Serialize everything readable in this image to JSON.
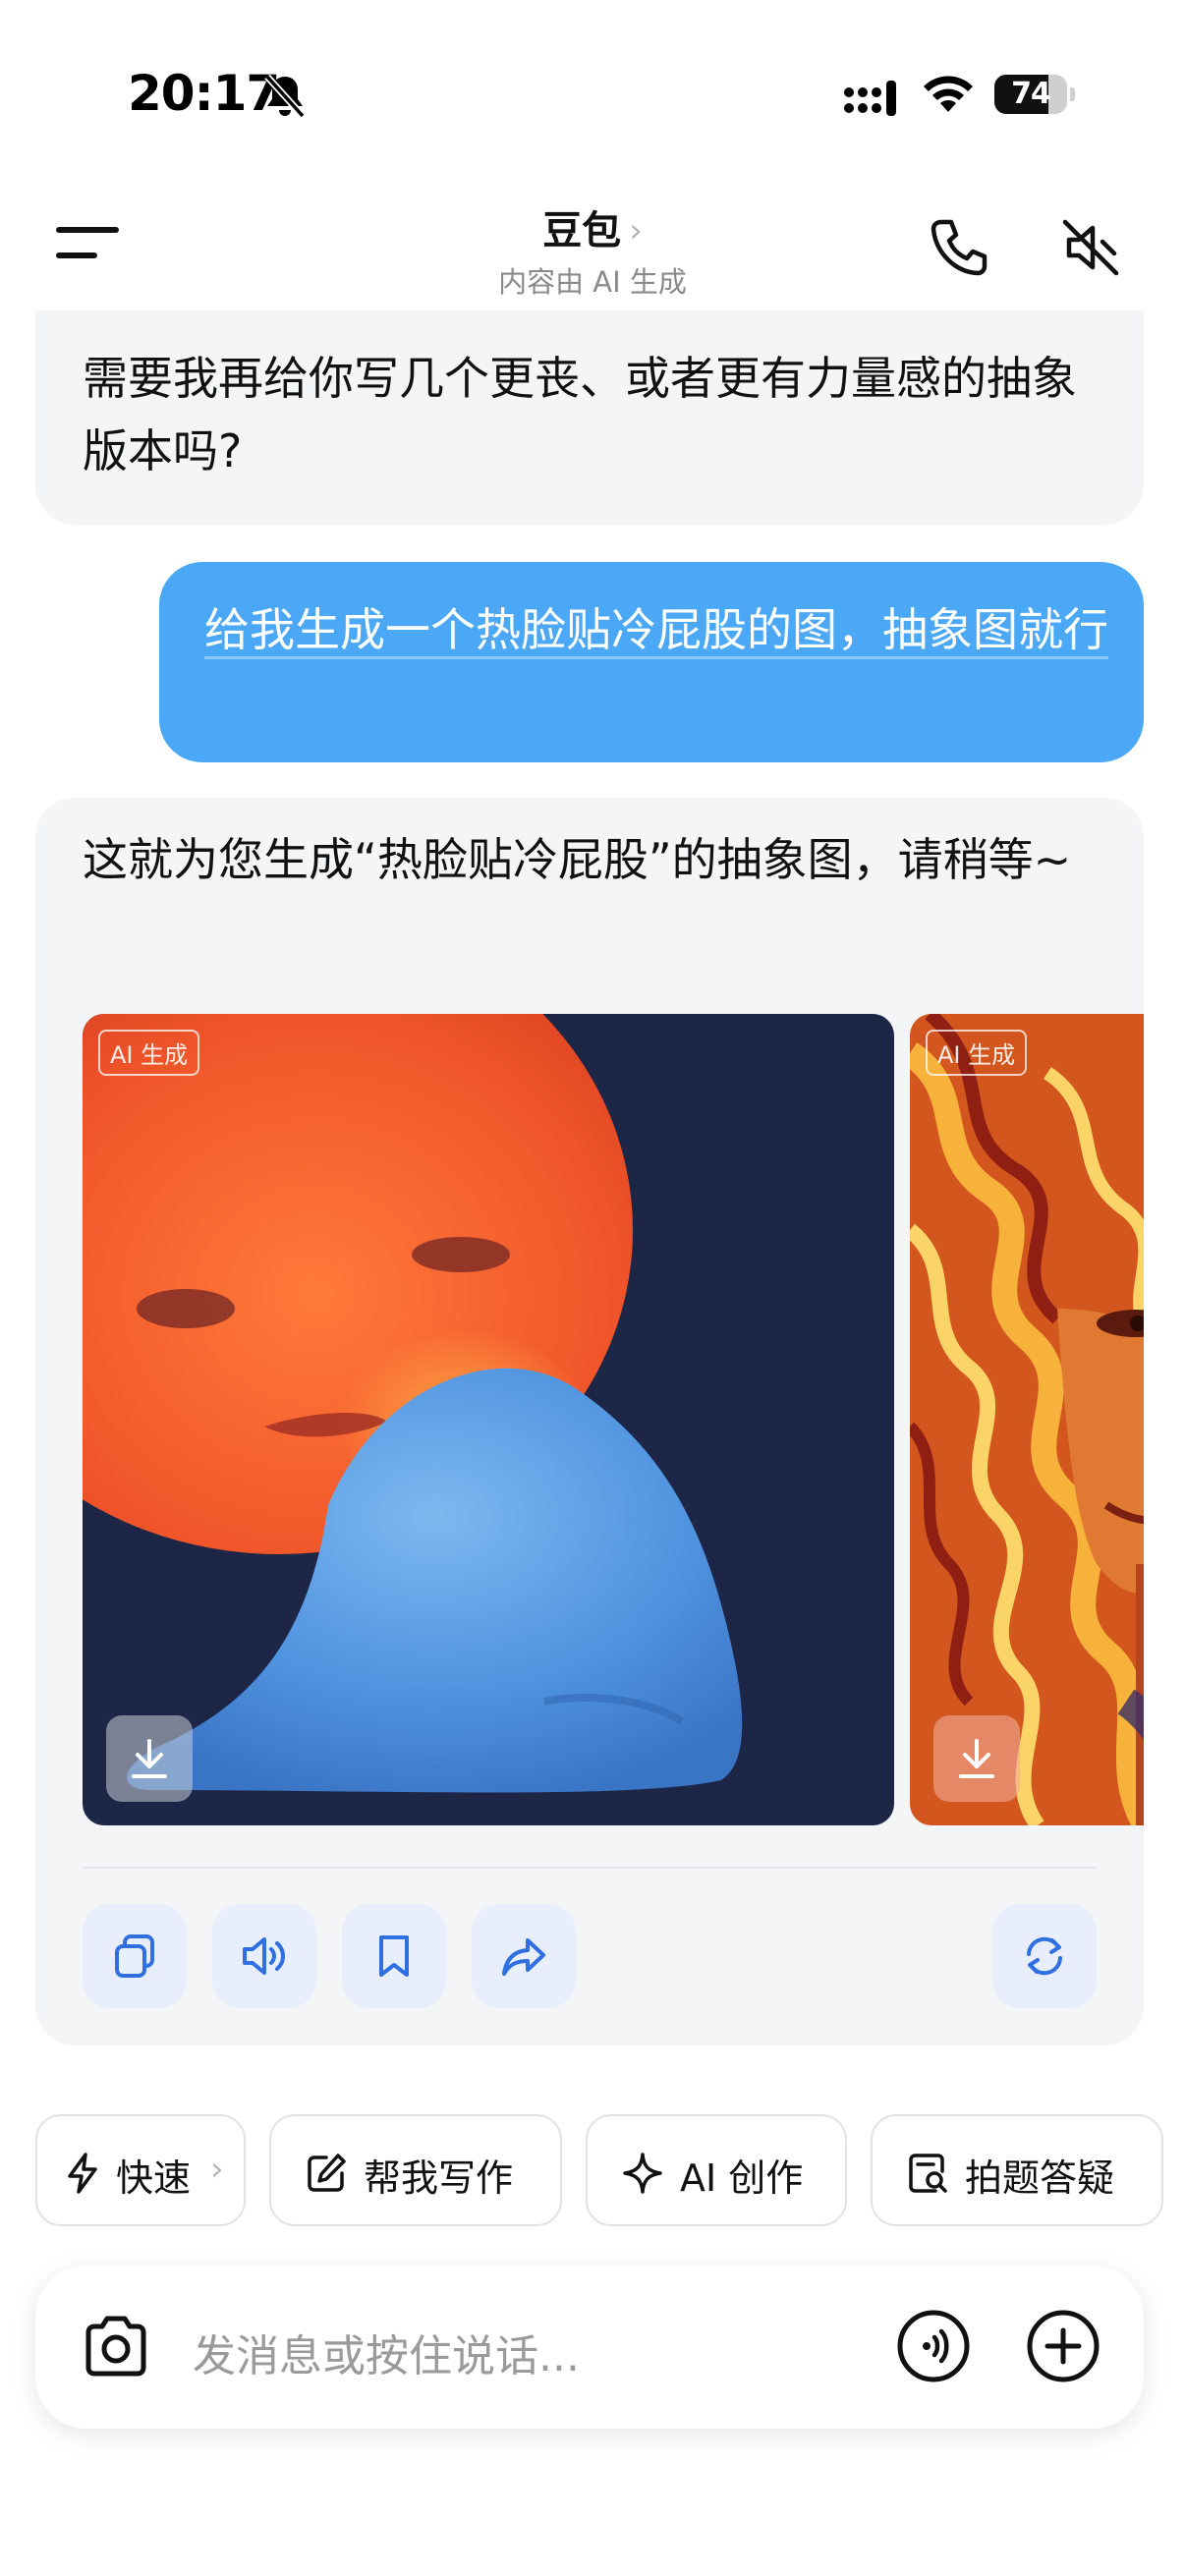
{
  "status_bar": {
    "time": "20:17",
    "battery_level": "74",
    "battery_fraction": 0.74,
    "icons": [
      "bell-slash-icon",
      "cellular-signal-icon",
      "wifi-icon",
      "battery-icon"
    ]
  },
  "header": {
    "title": "豆包",
    "title_chevron": "›",
    "subtitle": "内容由 AI 生成",
    "icons": [
      "menu-icon",
      "phone-icon",
      "speaker-mute-icon"
    ]
  },
  "messages": [
    {
      "role": "assistant",
      "text": "需要我再给你写几个更丧、或者更有力量感的抽象版本吗?"
    },
    {
      "role": "user",
      "text": "给我生成一个热脸贴冷屁股的图，抽象图就行"
    },
    {
      "role": "assistant",
      "text": "这就为您生成“热脸贴冷屁股”的抽象图，请稍等~",
      "images": [
        {
          "tag": "AI 生成",
          "icon": "download-icon"
        },
        {
          "tag": "AI 生成",
          "icon": "download-icon"
        }
      ],
      "actions": [
        "copy-icon",
        "speaker-icon",
        "bookmark-icon",
        "share-icon",
        "regenerate-icon"
      ]
    }
  ],
  "chips": [
    {
      "label": "快速",
      "icon": "lightning-icon",
      "chevron": "›"
    },
    {
      "label": "帮我写作",
      "icon": "edit-icon"
    },
    {
      "label": "AI 创作",
      "icon": "sparkle-icon"
    },
    {
      "label": "拍题答疑",
      "icon": "doc-search-icon"
    }
  ],
  "input": {
    "placeholder": "发消息或按住说话...",
    "icons": [
      "camera-icon",
      "voice-call-icon",
      "plus-icon"
    ]
  },
  "colors": {
    "accent": "#4ba8f7",
    "icon_blue": "#2f6fe0",
    "bubble_bg": "#f4f5f7",
    "action_bg": "#e8eefb"
  }
}
